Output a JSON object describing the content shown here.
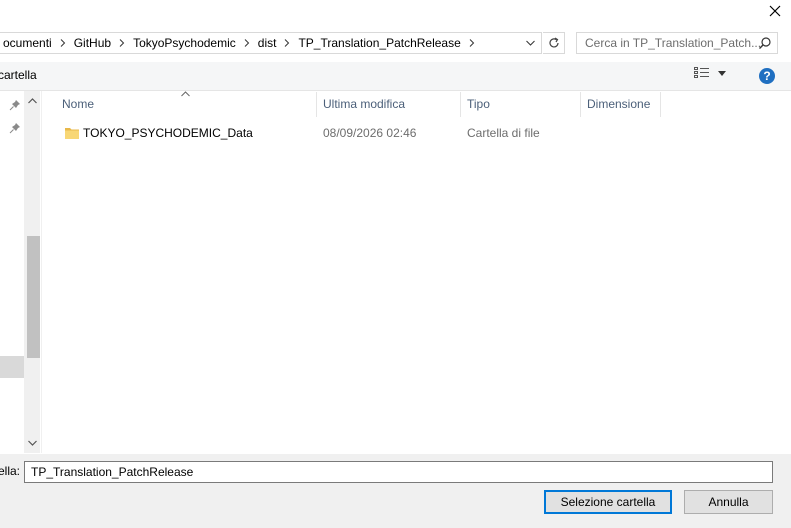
{
  "titlebar": {
    "close_icon": "close-icon"
  },
  "address": {
    "crumbs": [
      "ocumenti",
      "GitHub",
      "TokyoPsychodemic",
      "dist",
      "TP_Translation_PatchRelease"
    ],
    "search_placeholder": "Cerca in TP_Translation_Patch..."
  },
  "toolbar": {
    "new_folder_label": "cartella",
    "help_label": "?"
  },
  "columns": {
    "name": "Nome",
    "modified": "Ultima modifica",
    "type": "Tipo",
    "size": "Dimensione"
  },
  "files": [
    {
      "name": "TOKYO_PSYCHODEMIC_Data",
      "modified": "08/09/2026 02:46",
      "type": "Cartella di file",
      "size": ""
    }
  ],
  "bottom": {
    "folder_label": "ella:",
    "folder_value": "TP_Translation_PatchRelease",
    "select_button": "Selezione cartella",
    "cancel_button": "Annulla"
  },
  "colors": {
    "accent": "#0078d7",
    "header_text": "#4c607a",
    "folder": "#f8d775"
  }
}
